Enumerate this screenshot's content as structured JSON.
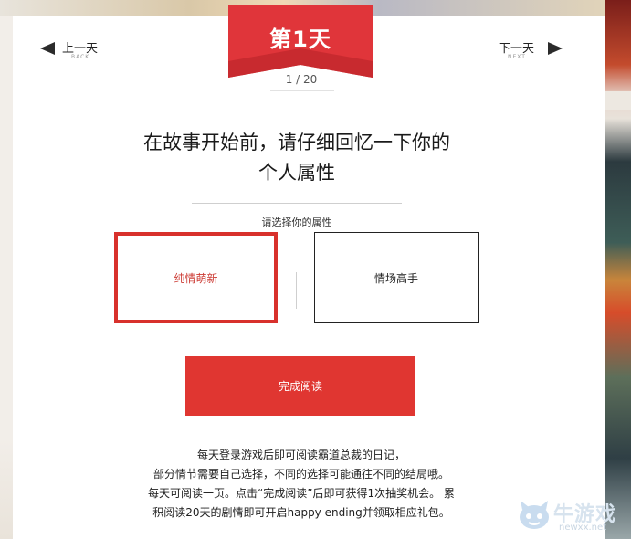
{
  "ribbon": {
    "title": "第1天"
  },
  "progress": {
    "current": 1,
    "total": 20,
    "text": "1 / 20"
  },
  "nav": {
    "prev": {
      "label": "上一天",
      "sub": "BACK"
    },
    "next": {
      "label": "下一天",
      "sub": "NEXT"
    }
  },
  "question": {
    "line1": "在故事开始前，请仔细回忆一下你的",
    "line2": "个人属性",
    "instruction": "请选择你的属性"
  },
  "options": [
    {
      "label": "纯情萌新",
      "selected": true
    },
    {
      "label": "情场高手",
      "selected": false
    }
  ],
  "finish_button": {
    "label": "完成阅读"
  },
  "description": {
    "line1": "每天登录游戏后即可阅读霸道总裁的日记，",
    "line2": "部分情节需要自己选择，不同的选择可能通往不同的结局哦。",
    "line3": "每天可阅读一页。点击“完成阅读”后即可获得1次抽奖机会。 累",
    "line4": "积阅读20天的剧情即可开启happy ending并领取相应礼包。"
  },
  "watermark": {
    "text": "牛游戏",
    "url": "newxx.net"
  },
  "colors": {
    "accent": "#e03631",
    "selected_border": "#d8312c",
    "ribbon": "#e0353a"
  },
  "icons": {
    "prev": "triangle-left-icon",
    "next": "triangle-right-icon",
    "mascot": "mascot-icon"
  }
}
